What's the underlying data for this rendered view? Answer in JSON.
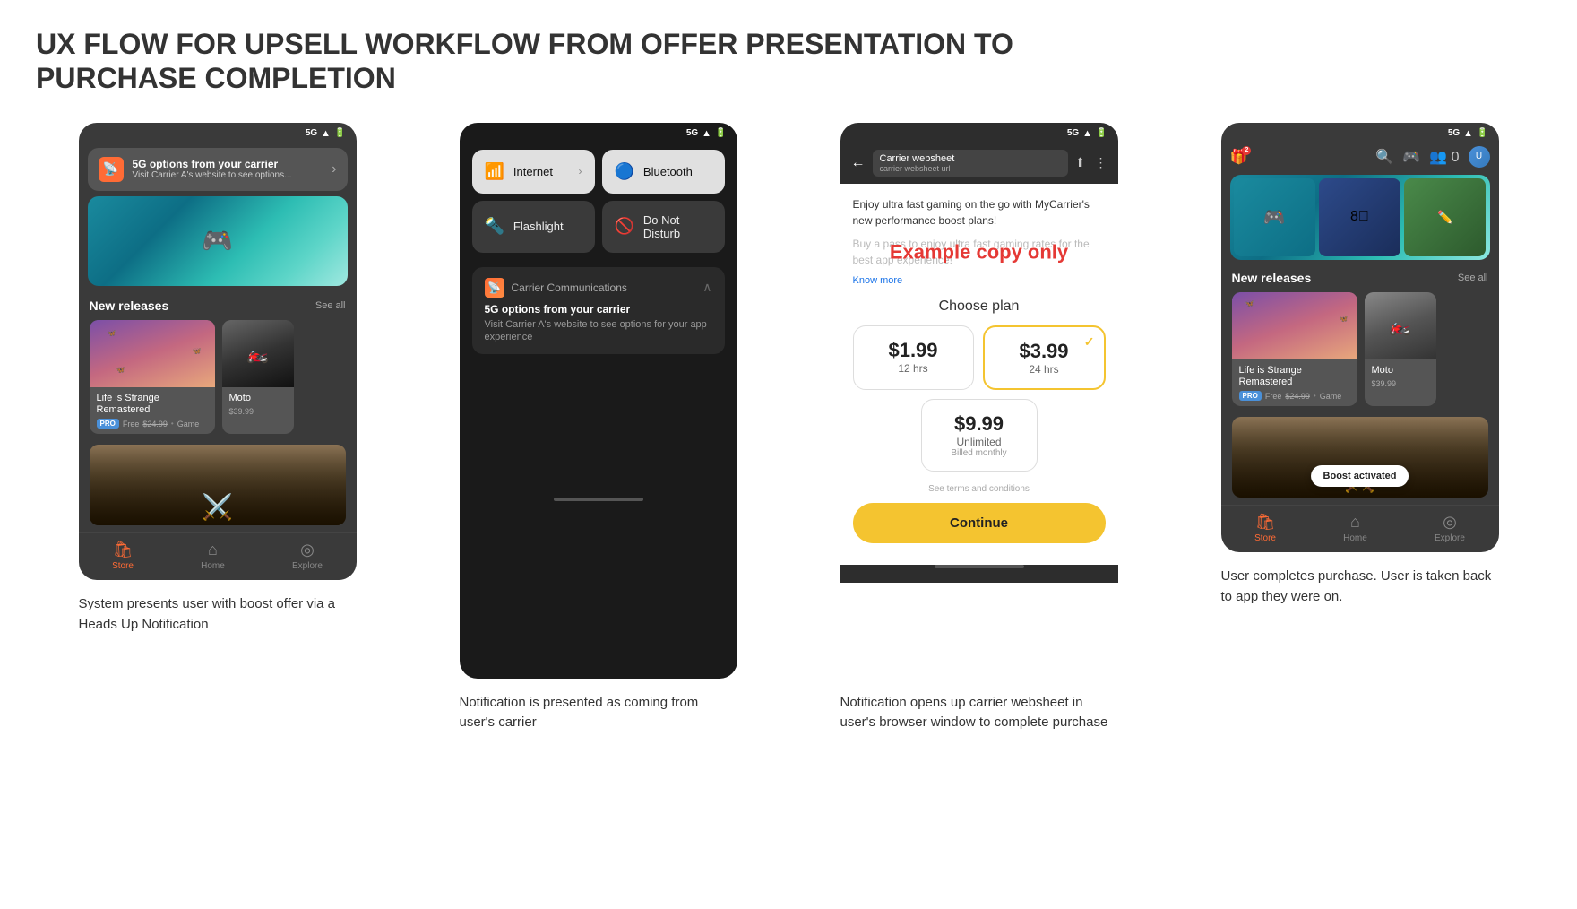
{
  "page": {
    "title": "UX FLOW FOR UPSELL WORKFLOW FROM OFFER PRESENTATION TO PURCHASE COMPLETION"
  },
  "screen1": {
    "status": "5G",
    "notif_title": "5G options from your carrier",
    "notif_sub": "Visit Carrier A's website to see options...",
    "section_title": "New releases",
    "see_all": "See all",
    "game1_title": "Life is Strange Remastered",
    "game1_pro": "PRO",
    "game1_free": "Free",
    "game1_price": "$24.99",
    "game1_type": "Game",
    "game2_title": "Moto",
    "game2_price": "$39.99",
    "caption": "System presents user with boost offer via a Heads Up Notification"
  },
  "screen2": {
    "status": "5G",
    "toggle_internet": "Internet",
    "toggle_bluetooth": "Bluetooth",
    "toggle_flashlight": "Flashlight",
    "toggle_dnd": "Do Not Disturb",
    "carrier_name": "Carrier Communications",
    "carrier_notif_main": "5G options from your carrier",
    "carrier_notif_desc": "Visit Carrier A's website to see options for your app experience",
    "caption": "Notification is presented as coming from user's carrier"
  },
  "screen3": {
    "status": "5G",
    "url_title": "Carrier websheet",
    "url_sub": "carrier websheet url",
    "promo_text": "Enjoy ultra fast gaming on the go with MyCarrier's new performance boost plans!",
    "promo_text2": "Buy a pass to enjoy ultra fast gaming rates for the best app experience!",
    "example_copy": "Example copy only",
    "know_more": "Know more",
    "choose_plan": "Choose plan",
    "plan1_price": "$1.99",
    "plan1_duration": "12 hrs",
    "plan2_price": "$3.99",
    "plan2_duration": "24 hrs",
    "plan3_price": "$9.99",
    "plan3_duration": "Unlimited",
    "plan3_billing": "Billed monthly",
    "terms": "See terms and conditions",
    "continue_btn": "Continue",
    "caption": "Notification opens up carrier websheet in user's browser window to complete purchase"
  },
  "screen4": {
    "status": "5G",
    "section_title": "New releases",
    "see_all": "See all",
    "game1_title": "Life is Strange Remastered",
    "game1_pro": "PRO",
    "game1_free": "Free",
    "game1_price": "$24.99",
    "game1_type": "Game",
    "game2_title": "Moto",
    "game2_price": "$39.99",
    "boost_activated": "Boost activated",
    "nav_store": "Store",
    "nav_home": "Home",
    "nav_explore": "Explore",
    "caption": "User completes purchase. User is taken back to app they were on."
  },
  "nav": {
    "store": "Store",
    "home": "Home",
    "explore": "Explore"
  }
}
